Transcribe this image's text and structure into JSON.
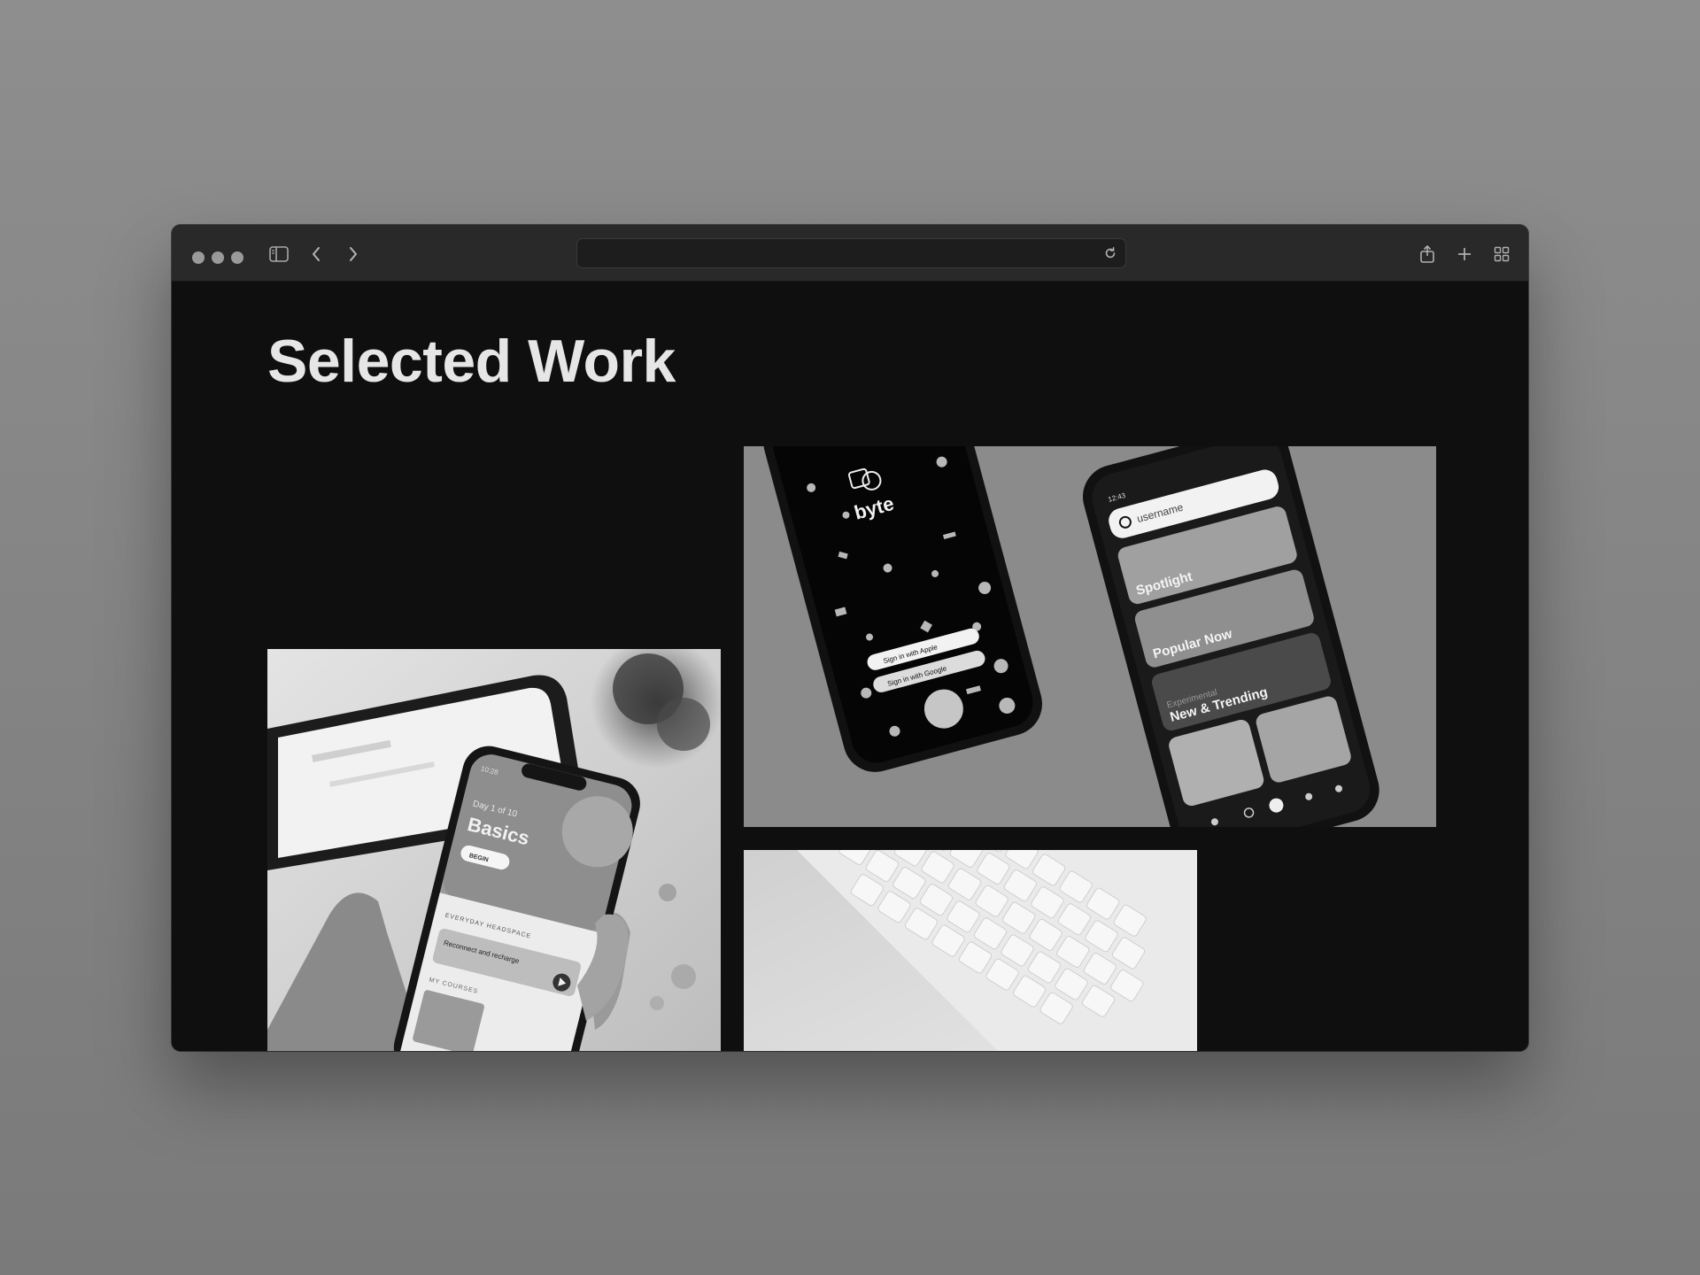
{
  "browser": {
    "address_bar": {
      "value": ""
    },
    "toolbar_icons": [
      "sidebar-icon",
      "back-arrow-icon",
      "forward-arrow-icon",
      "reload-icon",
      "share-icon",
      "plus-icon",
      "tabs-grid-icon"
    ]
  },
  "page": {
    "title": "Selected Work",
    "projects": [
      {
        "phone_screen": {
          "time": "10:28",
          "day": "Day 1 of 10",
          "course_title": "Basics",
          "begin_label": "BEGIN",
          "section_label": "EVERYDAY HEADSPACE",
          "session_label": "Reconnect and recharge",
          "courses_label": "MY COURSES"
        }
      },
      {
        "phone_left": {
          "brand": "byte",
          "sign_in_apple": "Sign in with Apple",
          "sign_in_google": "Sign in with Google"
        },
        "phone_right": {
          "time": "12:43",
          "search_placeholder": "username",
          "tiles": [
            "Spotlight",
            "Popular Now",
            "Experimental",
            "New & Trending"
          ]
        }
      },
      {
        "subject": "keyboard"
      }
    ]
  }
}
